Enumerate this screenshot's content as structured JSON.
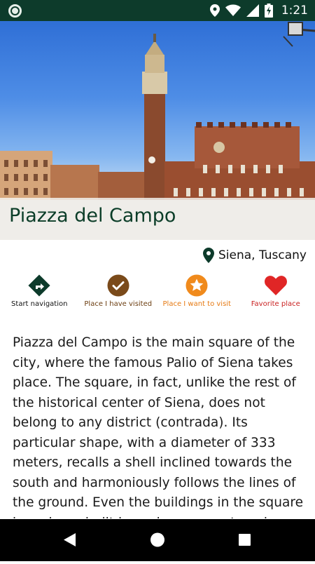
{
  "status_bar": {
    "time": "1:21",
    "icons": [
      "app-notification-icon",
      "location-icon",
      "wifi-icon",
      "signal-icon",
      "battery-icon"
    ]
  },
  "place": {
    "title": "Piazza del Campo",
    "location": "Siena, Tuscany",
    "description": "Piazza del Campo is the main square of the city, where the famous Palio of Siena takes place. The square, in fact, unlike the rest of the historical center of Siena, does not belong to any district (contrada). Its particular shape, with a diameter of 333 meters, recalls a shell inclined towards the south and harmoniously follows the lines of the ground. Even the buildings in the square have been built in such a way as to enhance their gentle inclined outline."
  },
  "actions": [
    {
      "label": "Start navigation",
      "icon": "navigation-icon",
      "color": "#0d3b2b"
    },
    {
      "label": "Place I have visited",
      "icon": "check-circle-icon",
      "color": "#7a4a1a"
    },
    {
      "label": "Place I want to visit",
      "icon": "star-circle-icon",
      "color": "#f08a1c"
    },
    {
      "label": "Favorite place",
      "icon": "heart-icon",
      "color": "#e02626"
    }
  ],
  "colors": {
    "status_bar": "#0d3b2b",
    "title": "#0b3d28",
    "nav_bar": "#000000"
  },
  "nav_bar": {
    "buttons": [
      "back-icon",
      "home-icon",
      "recents-icon"
    ]
  }
}
